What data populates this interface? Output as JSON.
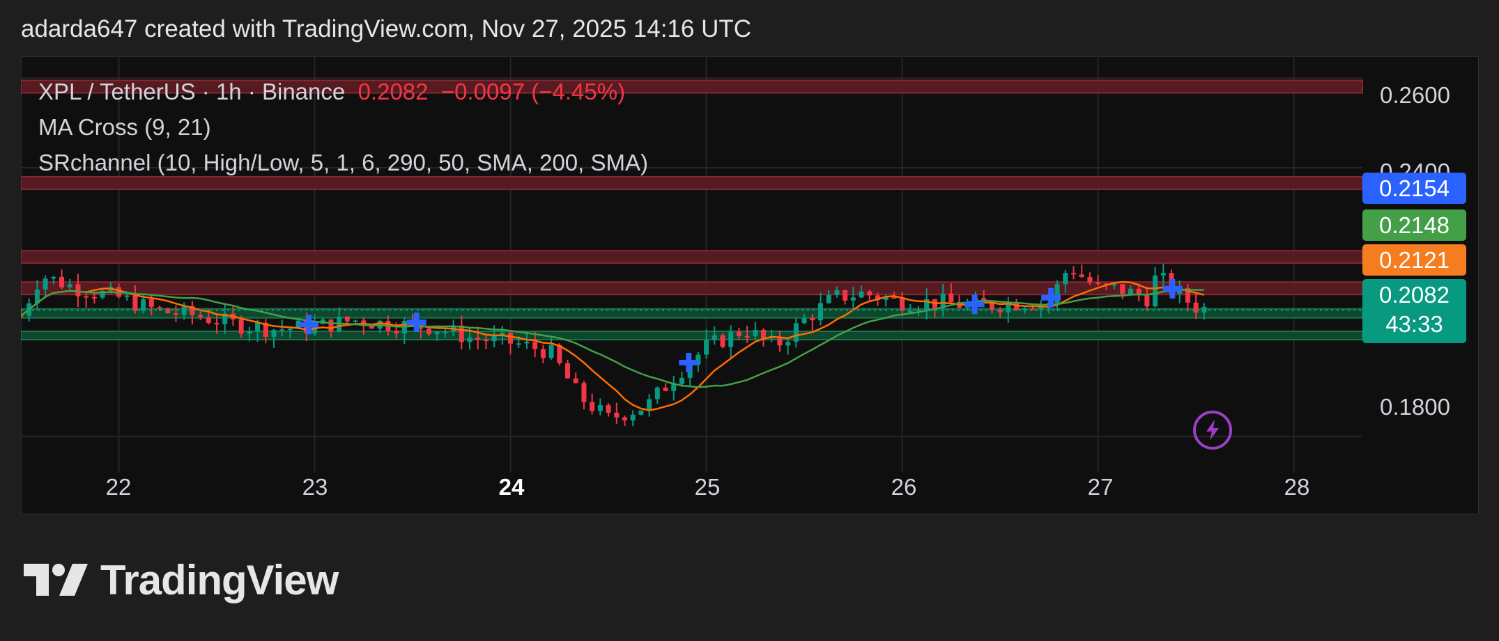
{
  "header": {
    "attribution": "adarda647 created with TradingView.com, Nov 27, 2025 14:16 UTC"
  },
  "legend": {
    "symbol": "XPL / TetherUS · 1h · Binance",
    "last": "0.2082",
    "change": "−0.0097 (−4.45%)",
    "indicator1": "MA Cross (9, 21)",
    "indicator2": "SRchannel (10, High/Low, 5, 1, 6, 290, 50, SMA, 200, SMA)"
  },
  "price_tags": {
    "blue": "0.2154",
    "green": "0.2148",
    "orange": "0.2121",
    "teal": "0.2082",
    "countdown": "43:33"
  },
  "axis": {
    "y_labels": [
      "0.2600",
      "0.2400",
      "0.1800"
    ],
    "x_labels": [
      "22",
      "23",
      "24",
      "25",
      "26",
      "27",
      "28"
    ]
  },
  "footer": {
    "brand": "TradingView"
  },
  "colors": {
    "up": "#089981",
    "down": "#f23645",
    "ma_fast": "#ff6d00",
    "ma_slow": "#43a047",
    "cross": "#2962ff",
    "resistance": "#5a1c22",
    "support": "#0d4a30"
  },
  "chart_data": {
    "type": "candlestick",
    "symbol": "XPL / TetherUS",
    "interval": "1h",
    "exchange": "Binance",
    "ylim": [
      0.171,
      0.263
    ],
    "x_range": [
      "21.5",
      "28.35"
    ],
    "x_ticks": [
      "22",
      "23",
      "24",
      "25",
      "26",
      "27",
      "28"
    ],
    "y_ticks": [
      0.26,
      0.24,
      0.18
    ],
    "grid": true,
    "last_price": 0.2082,
    "change": -0.0097,
    "change_pct": -4.45,
    "ma_fast_last": 0.2121,
    "ma_slow_last": 0.2148,
    "resistance_zones": [
      [
        0.2575,
        0.2595
      ],
      [
        0.2355,
        0.238
      ],
      [
        0.2195,
        0.2215
      ],
      [
        0.2125,
        0.2145
      ]
    ],
    "support_zones": [
      [
        0.2065,
        0.2085
      ],
      [
        0.2025,
        0.2035
      ]
    ],
    "ohlc_anchors": [
      [
        21.5,
        0.207
      ],
      [
        21.6,
        0.216
      ],
      [
        21.8,
        0.213
      ],
      [
        22.0,
        0.211
      ],
      [
        22.2,
        0.208
      ],
      [
        22.4,
        0.207
      ],
      [
        22.6,
        0.205
      ],
      [
        22.8,
        0.204
      ],
      [
        23.0,
        0.2045
      ],
      [
        23.2,
        0.206
      ],
      [
        23.4,
        0.205
      ],
      [
        23.6,
        0.2045
      ],
      [
        23.8,
        0.202
      ],
      [
        24.0,
        0.201
      ],
      [
        24.2,
        0.199
      ],
      [
        24.35,
        0.189
      ],
      [
        24.5,
        0.184
      ],
      [
        24.7,
        0.187
      ],
      [
        24.85,
        0.194
      ],
      [
        25.0,
        0.2
      ],
      [
        25.2,
        0.204
      ],
      [
        25.35,
        0.2
      ],
      [
        25.5,
        0.206
      ],
      [
        25.65,
        0.211
      ],
      [
        25.8,
        0.212
      ],
      [
        26.0,
        0.21
      ],
      [
        26.2,
        0.21
      ],
      [
        26.4,
        0.209
      ],
      [
        26.6,
        0.21
      ],
      [
        26.75,
        0.21
      ],
      [
        26.85,
        0.218
      ],
      [
        27.0,
        0.213
      ],
      [
        27.1,
        0.213
      ],
      [
        27.25,
        0.211
      ],
      [
        27.3,
        0.216
      ],
      [
        27.4,
        0.212
      ],
      [
        27.5,
        0.209
      ],
      [
        27.58,
        0.2082
      ]
    ],
    "cross_markers": [
      [
        22.97,
        0.205
      ],
      [
        23.52,
        0.2055
      ],
      [
        24.91,
        0.1965
      ],
      [
        26.37,
        0.2095
      ],
      [
        26.76,
        0.211
      ],
      [
        27.38,
        0.213
      ]
    ]
  }
}
